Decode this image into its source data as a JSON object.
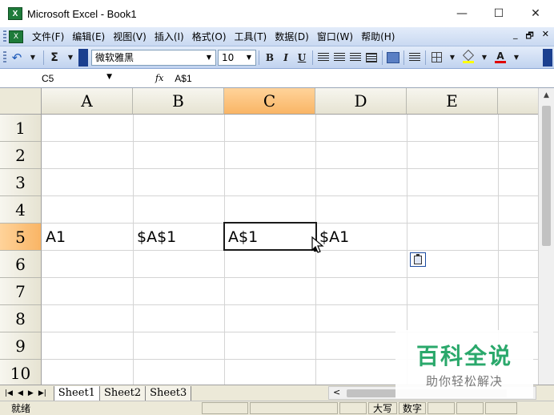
{
  "window": {
    "title": "Microsoft Excel - Book1",
    "app_icon": "excel-icon",
    "app_icon_glyph": "X",
    "minimize_glyph": "—",
    "maximize_glyph": "☐",
    "close_glyph": "✕"
  },
  "menubar": {
    "items": [
      "文件(F)",
      "编辑(E)",
      "视图(V)",
      "插入(I)",
      "格式(O)",
      "工具(T)",
      "数据(D)",
      "窗口(W)",
      "帮助(H)"
    ],
    "right_glyphs": [
      "_",
      "🗗",
      "✕"
    ]
  },
  "toolbar": {
    "undo_glyph": "↶",
    "sum_glyph": "Σ",
    "font_name": "微软雅黑",
    "font_size": "10",
    "bold": "B",
    "italic": "I",
    "underline": "U",
    "font_color_glyph": "A",
    "dropdown_glyph": "▼"
  },
  "formulabar": {
    "name_box": "C5",
    "fx_label": "fx",
    "formula": "A$1"
  },
  "columns": [
    "A",
    "B",
    "C",
    "D",
    "E"
  ],
  "active_column": "C",
  "rows": [
    "1",
    "2",
    "3",
    "4",
    "5",
    "6",
    "7",
    "8",
    "9",
    "10"
  ],
  "active_row": "5",
  "cells": {
    "A5": "A1",
    "B5": "$A$1",
    "C5": "A$1",
    "D5": "$A1"
  },
  "sheets": {
    "nav_glyphs": [
      "|◀",
      "◀",
      "▶",
      "▶|"
    ],
    "tabs": [
      "Sheet1",
      "Sheet2",
      "Sheet3"
    ],
    "hscroll_left_glyph": "<"
  },
  "statusbar": {
    "ready": "就绪",
    "caps": "大写",
    "num": "数字"
  },
  "watermark": {
    "title": "百科全说",
    "subtitle": "助你轻松解决"
  },
  "colors": {
    "active_header": "#f9b565",
    "toolbar_blue": "#c9d9f1",
    "watermark_green": "#2aa86b"
  }
}
